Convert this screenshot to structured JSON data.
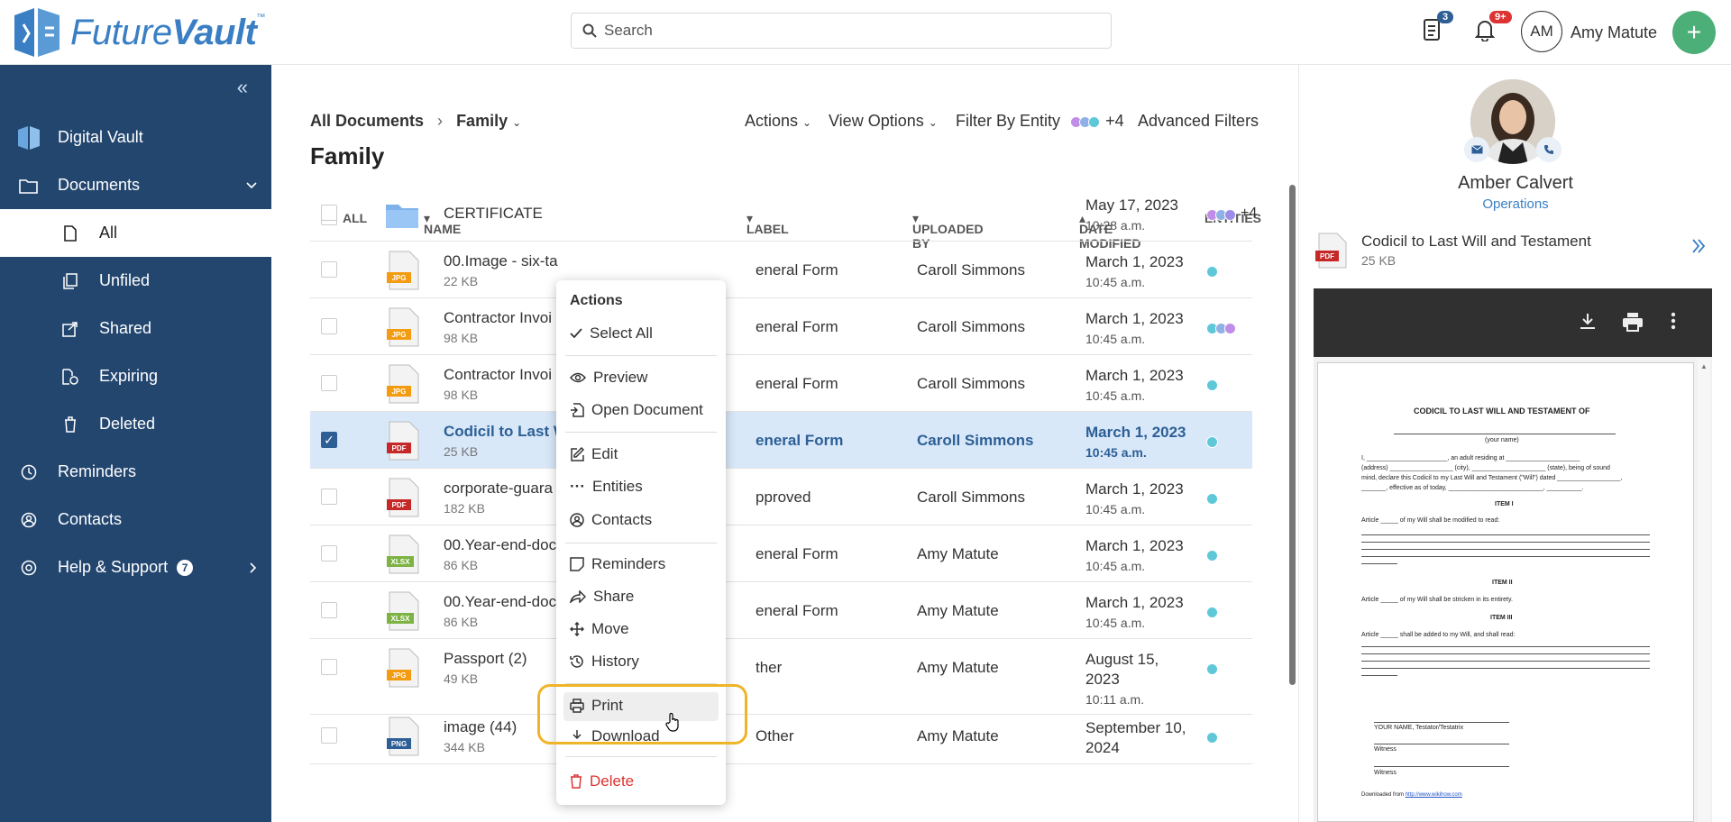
{
  "app": {
    "logo_text_light": "Future",
    "logo_text_bold": "Vault",
    "tm": "™"
  },
  "topbar": {
    "search_placeholder": "Search",
    "docs_badge": "3",
    "notif_badge": "9+",
    "user_initials": "AM",
    "user_name": "Amy Matute"
  },
  "sidebar": {
    "items": [
      {
        "label": "Digital Vault"
      },
      {
        "label": "Documents"
      },
      {
        "label": "All"
      },
      {
        "label": "Unfiled"
      },
      {
        "label": "Shared"
      },
      {
        "label": "Expiring"
      },
      {
        "label": "Deleted"
      },
      {
        "label": "Reminders"
      },
      {
        "label": "Contacts"
      },
      {
        "label": "Help & Support",
        "badge": "7"
      }
    ]
  },
  "main": {
    "breadcrumb_root": "All Documents",
    "breadcrumb_current": "Family",
    "title": "Family",
    "actions_label": "Actions",
    "view_options_label": "View Options",
    "filter_label": "Filter By Entity",
    "filter_count": "+4",
    "advanced_filters": "Advanced Filters",
    "columns": {
      "all": "ALL",
      "name": "NAME",
      "label": "LABEL",
      "uploaded_by": "UPLOADED BY",
      "date_modified": "DATE MODIFIED",
      "entities": "ENTITIES"
    },
    "rows": [
      {
        "name": "CERTIFICATE",
        "size": "",
        "label": "",
        "user": "",
        "date": "May 17, 2023",
        "time": "10:28 a.m.",
        "type": "folder",
        "extra": "+4"
      },
      {
        "name": "00.Image - six-ta",
        "size": "22 KB",
        "label": "eneral Form",
        "user": "Caroll Simmons",
        "date": "March 1, 2023",
        "time": "10:45 a.m.",
        "type": "JPG"
      },
      {
        "name": "Contractor Invoi",
        "size": "98 KB",
        "label": "eneral Form",
        "user": "Caroll Simmons",
        "date": "March 1, 2023",
        "time": "10:45 a.m.",
        "type": "JPG"
      },
      {
        "name": "Contractor Invoi",
        "size": "98 KB",
        "label": "eneral Form",
        "user": "Caroll Simmons",
        "date": "March 1, 2023",
        "time": "10:45 a.m.",
        "type": "JPG"
      },
      {
        "name": "Codicil to Last W",
        "size": "25 KB",
        "label": "eneral Form",
        "user": "Caroll Simmons",
        "date": "March 1, 2023",
        "time": "10:45 a.m.",
        "type": "PDF"
      },
      {
        "name": "corporate-guara",
        "size": "182 KB",
        "label": "pproved",
        "user": "Caroll Simmons",
        "date": "March 1, 2023",
        "time": "10:45 a.m.",
        "type": "PDF"
      },
      {
        "name": "00.Year-end-doc",
        "size": "86 KB",
        "label": "eneral Form",
        "user": "Amy Matute",
        "date": "March 1, 2023",
        "time": "10:45 a.m.",
        "type": "XLSX"
      },
      {
        "name": "00.Year-end-doc",
        "size": "86 KB",
        "label": "eneral Form",
        "user": "Amy Matute",
        "date": "March 1, 2023",
        "time": "10:45 a.m.",
        "type": "XLSX"
      },
      {
        "name": "Passport (2)",
        "size": "49 KB",
        "label": "ther",
        "user": "Amy Matute",
        "date": "August 15,",
        "date2": "2023",
        "time": "10:11 a.m.",
        "type": "JPG"
      },
      {
        "name": "image (44)",
        "size": "344 KB",
        "label": "Other",
        "user": "Amy Matute",
        "date": "September 10,",
        "date2": "2024",
        "time": "",
        "type": "PNG"
      }
    ]
  },
  "menu": {
    "title": "Actions",
    "items": [
      "Select All",
      "Preview",
      "Open Document",
      "Edit",
      "Entities",
      "Contacts",
      "Reminders",
      "Share",
      "Move",
      "History",
      "Print",
      "Download",
      "Delete"
    ]
  },
  "panel": {
    "name": "Amber Calvert",
    "role": "Operations",
    "doc_name": "Codicil to Last Will and Testament",
    "doc_size": "25 KB",
    "pdf": {
      "title": "CODICIL TO LAST WILL AND TESTAMENT OF",
      "your_name": "(your name)",
      "intro1": "I, _______________________, an adult residing at _____________________",
      "intro2": "(address) __________________ (city), _____________________ (state), being of sound",
      "intro3": "mind, declare this Codicil to my Last Will and Testament (\"Will\") dated __________________,",
      "intro4": "_______, effective as of today, ___________________________, __________.",
      "item1": "ITEM I",
      "item1_text": "Article _____ of my Will shall be modified to read:",
      "item2": "ITEM II",
      "item2_text": "Article _____ of my Will shall be stricken in its entirety.",
      "item3": "ITEM III",
      "item3_text": "Article _____ shall be added to my Will, and shall read:",
      "sig1": "YOUR NAME, Testator/Testatrix",
      "sig2": "Witness",
      "sig3": "Witness",
      "download_prefix": "Downloaded from",
      "download_link": "http://www.wikihow.com"
    }
  },
  "colors": {
    "sidebar": "#23466f",
    "accent": "#3a7fc4",
    "selected_row": "#d8e8f8",
    "highlight": "#f0b429",
    "delete": "#dd3333"
  }
}
